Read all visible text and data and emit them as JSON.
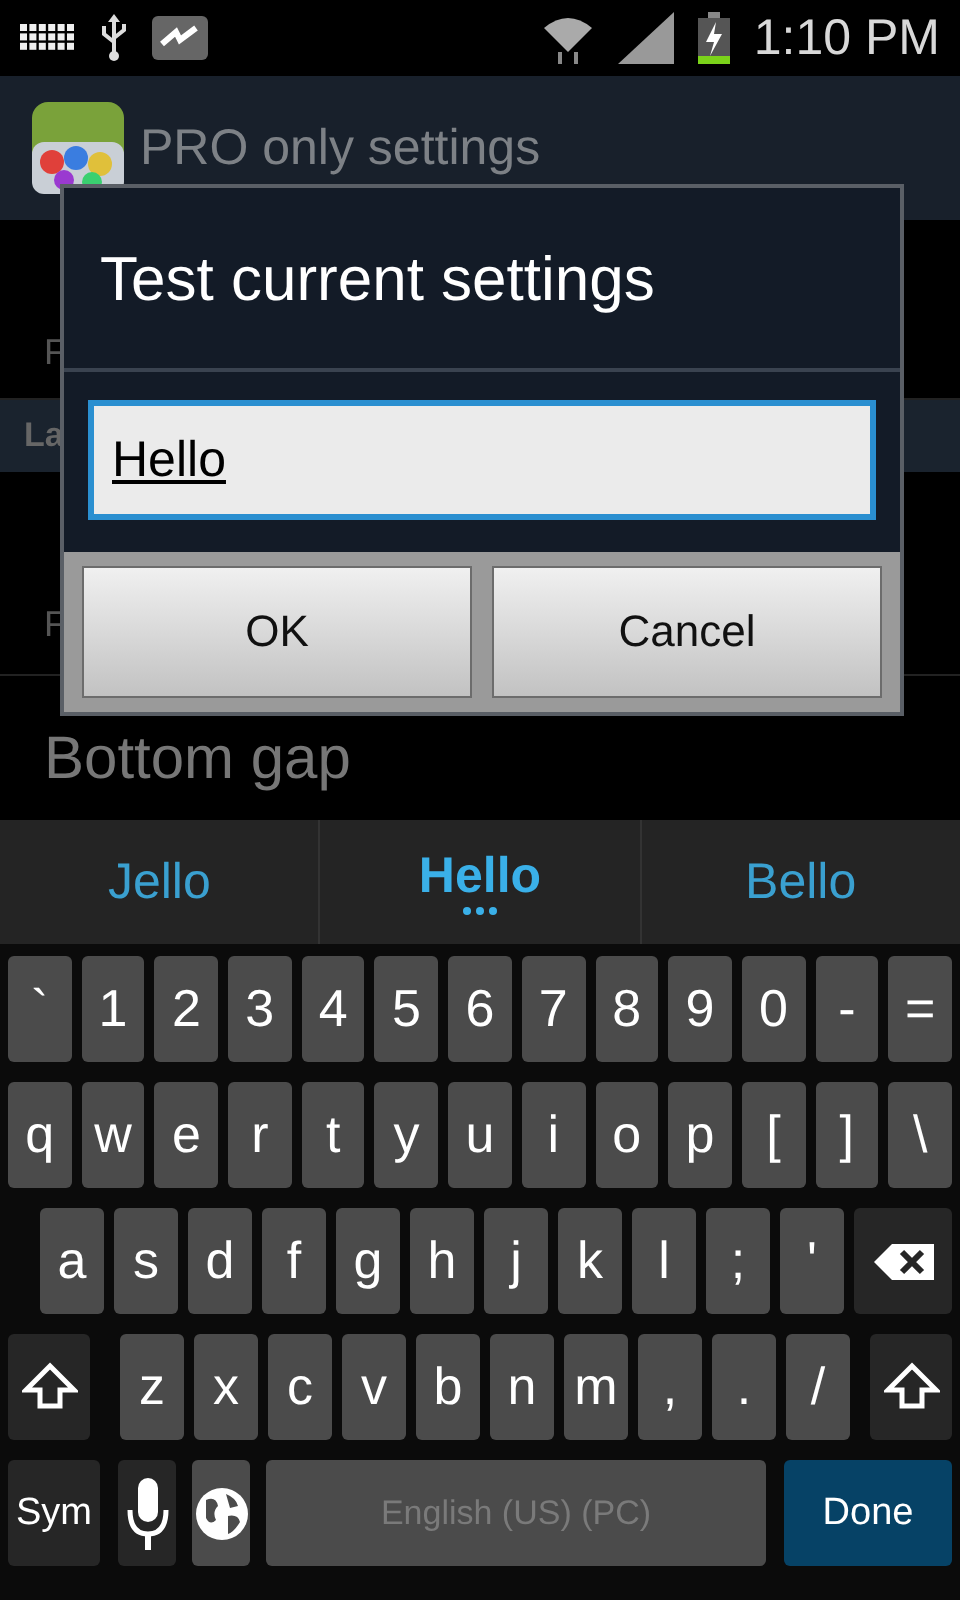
{
  "status_bar": {
    "time": "1:10 PM"
  },
  "action_bar": {
    "title": "PRO only settings"
  },
  "background_list": [
    {
      "kind": "item",
      "summary": "F"
    },
    {
      "kind": "header",
      "title": "La"
    },
    {
      "kind": "item",
      "summary": "F"
    },
    {
      "kind": "item",
      "title": "Bottom gap"
    }
  ],
  "dialog": {
    "title": "Test current settings",
    "input": {
      "value": "Hello",
      "focused": true
    },
    "buttons": [
      "OK",
      "Cancel"
    ]
  },
  "keyboard": {
    "suggestions": [
      {
        "text": "Jello",
        "selected": false
      },
      {
        "text": "Hello",
        "selected": true
      },
      {
        "text": "Bello",
        "selected": false
      }
    ],
    "rows": [
      [
        {
          "kind": "char",
          "label": "`"
        },
        {
          "kind": "char",
          "label": "1"
        },
        {
          "kind": "char",
          "label": "2"
        },
        {
          "kind": "char",
          "label": "3"
        },
        {
          "kind": "char",
          "label": "4"
        },
        {
          "kind": "char",
          "label": "5"
        },
        {
          "kind": "char",
          "label": "6"
        },
        {
          "kind": "char",
          "label": "7"
        },
        {
          "kind": "char",
          "label": "8"
        },
        {
          "kind": "char",
          "label": "9"
        },
        {
          "kind": "char",
          "label": "0"
        },
        {
          "kind": "char",
          "label": "-"
        },
        {
          "kind": "char",
          "label": "="
        }
      ],
      [
        {
          "kind": "char",
          "label": "q"
        },
        {
          "kind": "char",
          "label": "w"
        },
        {
          "kind": "char",
          "label": "e"
        },
        {
          "kind": "char",
          "label": "r"
        },
        {
          "kind": "char",
          "label": "t"
        },
        {
          "kind": "char",
          "label": "y"
        },
        {
          "kind": "char",
          "label": "u"
        },
        {
          "kind": "char",
          "label": "i"
        },
        {
          "kind": "char",
          "label": "o"
        },
        {
          "kind": "char",
          "label": "p"
        },
        {
          "kind": "char",
          "label": "["
        },
        {
          "kind": "char",
          "label": "]"
        },
        {
          "kind": "char",
          "label": "\\"
        }
      ],
      [
        {
          "kind": "char",
          "label": "a"
        },
        {
          "kind": "char",
          "label": "s"
        },
        {
          "kind": "char",
          "label": "d"
        },
        {
          "kind": "char",
          "label": "f"
        },
        {
          "kind": "char",
          "label": "g"
        },
        {
          "kind": "char",
          "label": "h"
        },
        {
          "kind": "char",
          "label": "j"
        },
        {
          "kind": "char",
          "label": "k"
        },
        {
          "kind": "char",
          "label": "l"
        },
        {
          "kind": "char",
          "label": ";"
        },
        {
          "kind": "char",
          "label": "'"
        },
        {
          "kind": "backspace"
        }
      ],
      [
        {
          "kind": "shift"
        },
        {
          "kind": "char",
          "label": "z"
        },
        {
          "kind": "char",
          "label": "x"
        },
        {
          "kind": "char",
          "label": "c"
        },
        {
          "kind": "char",
          "label": "v"
        },
        {
          "kind": "char",
          "label": "b"
        },
        {
          "kind": "char",
          "label": "n"
        },
        {
          "kind": "char",
          "label": "m"
        },
        {
          "kind": "char",
          "label": ","
        },
        {
          "kind": "char",
          "label": "."
        },
        {
          "kind": "char",
          "label": "/"
        },
        {
          "kind": "shift"
        }
      ]
    ],
    "bottom_row": [
      {
        "kind": "sym",
        "label": "Sym"
      },
      {
        "kind": "mic"
      },
      {
        "kind": "globe"
      },
      {
        "kind": "space",
        "label": "English (US) (PC)"
      },
      {
        "kind": "done",
        "label": "Done"
      }
    ]
  }
}
